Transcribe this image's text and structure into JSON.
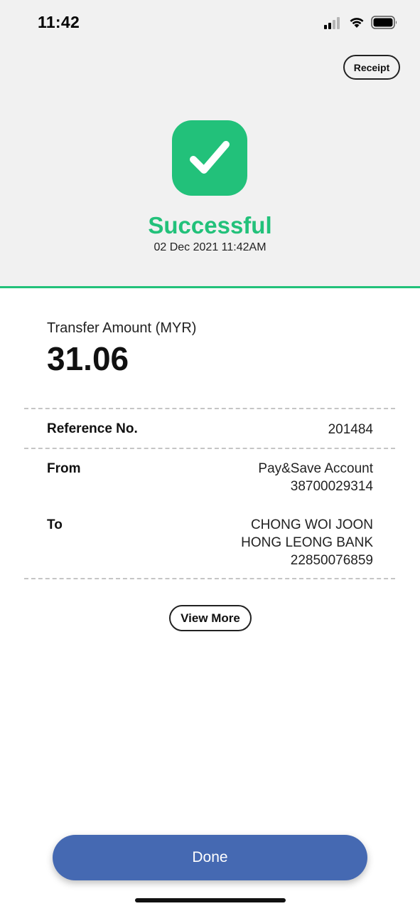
{
  "status_bar": {
    "time": "11:42",
    "signal_icon": "signal-bars-icon",
    "wifi_icon": "wifi-icon",
    "battery_icon": "battery-icon"
  },
  "header": {
    "receipt_label": "Receipt",
    "status_icon": "checkmark-icon",
    "status_title": "Successful",
    "status_datetime": "02 Dec 2021 11:42AM"
  },
  "amount": {
    "label": "Transfer Amount (MYR)",
    "value": "31.06"
  },
  "details": {
    "reference": {
      "label": "Reference No.",
      "value": "201484"
    },
    "from": {
      "label": "From",
      "lines": [
        "Pay&Save Account",
        "38700029314"
      ]
    },
    "to": {
      "label": "To",
      "lines": [
        "CHONG WOI JOON",
        "HONG LEONG BANK",
        "22850076859"
      ]
    }
  },
  "view_more_label": "View More",
  "done_label": "Done",
  "colors": {
    "success": "#22c17a",
    "primary_button": "#4569b2",
    "header_bg": "#f1f1f1"
  }
}
